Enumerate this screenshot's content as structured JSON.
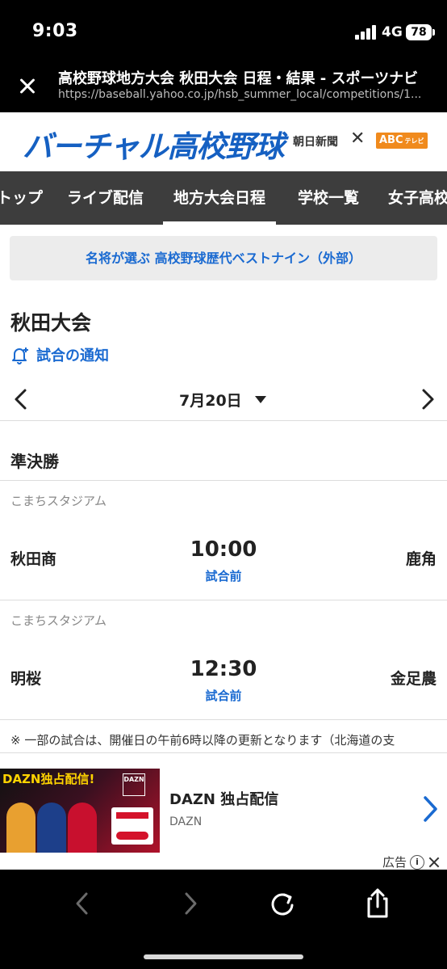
{
  "status_bar": {
    "time": "9:03",
    "network": "4G",
    "battery": "78"
  },
  "browser": {
    "page_title": "高校野球地方大会 秋田大会 日程・結果 - スポーツナビ",
    "url": "https://baseball.yahoo.co.jp/hsb_summer_local/competitions/1..."
  },
  "site": {
    "logo": "バーチャル高校野球",
    "partner1": "朝日新聞",
    "partner_separator": "✕",
    "partner2": "ABC",
    "partner2_suffix": "テレビ"
  },
  "nav": {
    "items": [
      {
        "label": "トップ"
      },
      {
        "label": "ライブ配信"
      },
      {
        "label": "地方大会日程"
      },
      {
        "label": "学校一覧"
      },
      {
        "label": "女子高校野球"
      }
    ]
  },
  "promo": {
    "text": "名将が選ぶ 高校野球歴代ベストナイン（外部）"
  },
  "tournament": {
    "title": "秋田大会",
    "notify_label": "試合の通知",
    "date": "7月20日"
  },
  "round": "準決勝",
  "matches": [
    {
      "venue": "こまちスタジアム",
      "home": "秋田商",
      "time": "10:00",
      "status": "試合前",
      "away": "鹿角"
    },
    {
      "venue": "こまちスタジアム",
      "home": "明桜",
      "time": "12:30",
      "status": "試合前",
      "away": "金足農"
    }
  ],
  "note": "※ 一部の試合は、開催日の午前6時以降の更新となります（北海道の支",
  "ad": {
    "image_headline": "DAZN独占配信!",
    "image_logo": "DAZN",
    "title": "DAZN 独占配信",
    "sponsor": "DAZN",
    "label": "広告",
    "info_glyph": "i"
  },
  "colors": {
    "accent_blue": "#1a6ad1",
    "nav_bg": "#3d3d3d",
    "logo_blue": "#1560c2",
    "abc_orange": "#f08a1d"
  }
}
